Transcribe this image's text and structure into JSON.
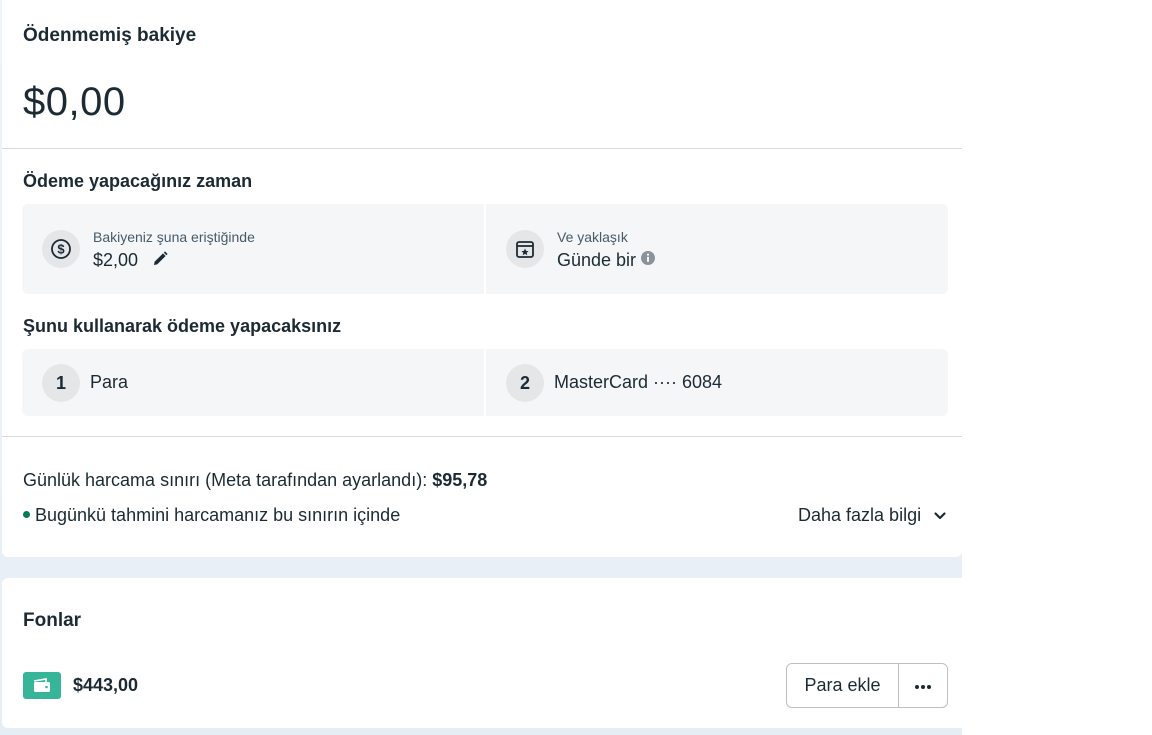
{
  "balance": {
    "title": "Ödenmemiş bakiye",
    "amount": "$0,00"
  },
  "payment_timing": {
    "title": "Ödeme yapacağınız zaman",
    "threshold_label": "Bakiyeniz şuna eriştiğinde",
    "threshold_value": "$2,00",
    "approx_label": "Ve yaklaşık",
    "approx_value": "Günde bir"
  },
  "payment_methods": {
    "title": "Şunu kullanarak ödeme yapacaksınız",
    "items": [
      {
        "index": "1",
        "label": "Para"
      },
      {
        "index": "2",
        "label": "MasterCard ···· 6084"
      }
    ]
  },
  "spending": {
    "limit_text": "Günlük harcama sınırı (Meta tarafından ayarlandı): ",
    "limit_value": "$95,78",
    "status_text": "Bugünkü tahmini harcamanız bu sınırın içinde",
    "status_color": "#0a7a55",
    "more_info": "Daha fazla bilgi"
  },
  "funds": {
    "title": "Fonlar",
    "amount": "$443,00",
    "add_button": "Para ekle",
    "wallet_color": "#36b598"
  },
  "icons": [
    "dollar-circle-icon",
    "pencil-icon",
    "calendar-star-icon",
    "info-icon",
    "chevron-down-icon",
    "wallet-icon",
    "more-dots-icon"
  ]
}
